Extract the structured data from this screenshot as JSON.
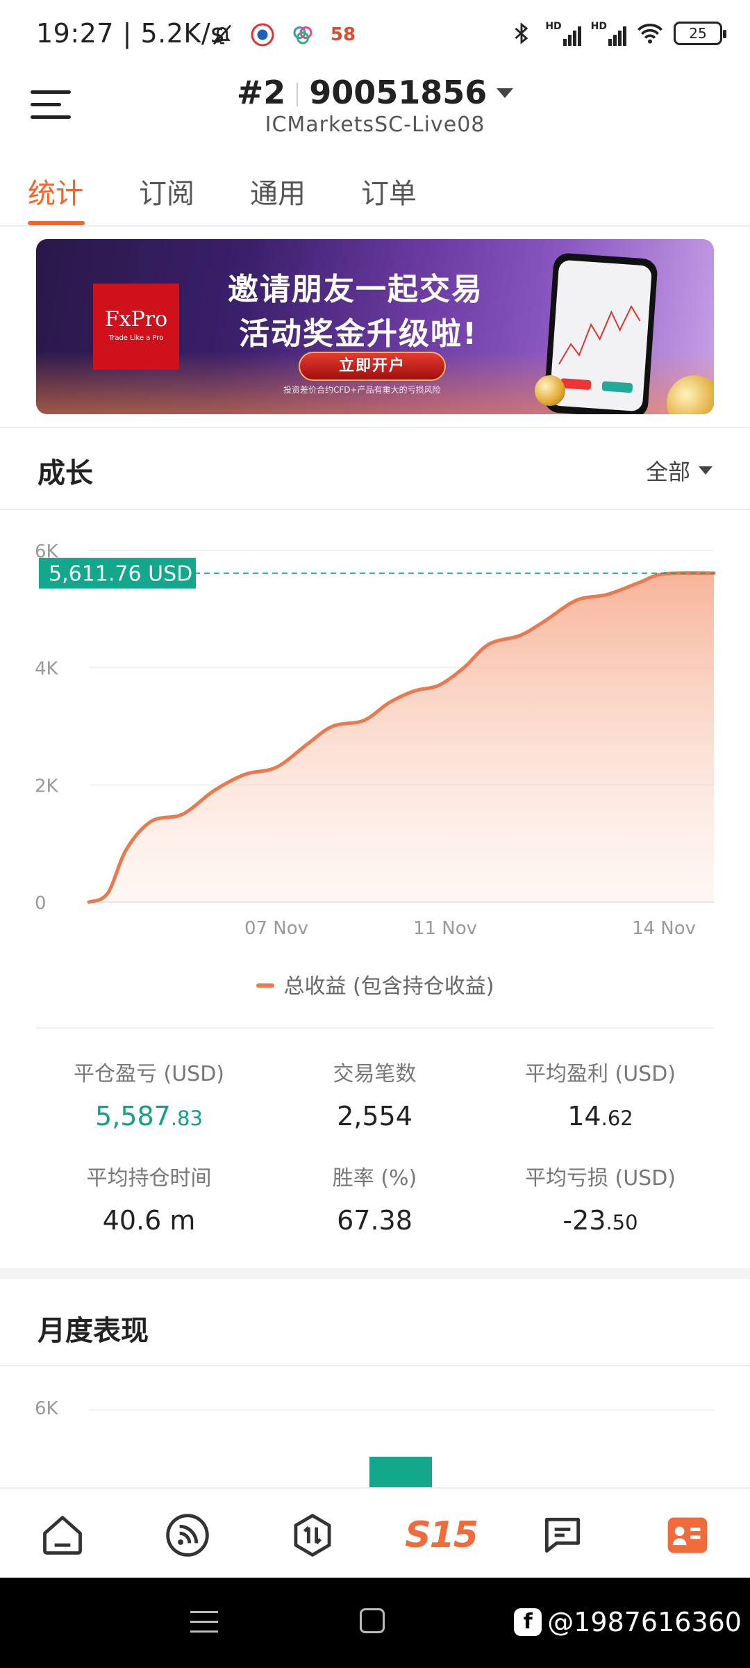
{
  "status_bar": {
    "time": "19:27",
    "speed": "5.2K/s",
    "signal1": "HD",
    "signal2": "HD",
    "battery": "25",
    "app_badge": "58"
  },
  "header": {
    "account_prefix": "#2",
    "account_number": "90051856",
    "server": "ICMarketsSC-Live08"
  },
  "tabs": [
    {
      "label": "统计",
      "active": true
    },
    {
      "label": "订阅",
      "active": false
    },
    {
      "label": "通用",
      "active": false
    },
    {
      "label": "订单",
      "active": false
    }
  ],
  "banner": {
    "logo": "FxPro",
    "logo_tag": "Trade Like a Pro",
    "line1": "邀请朋友一起交易",
    "line2": "活动奖金升级啦!",
    "cta": "立即开户",
    "risk": "投资差价合约CFD+产品有重大的亏损风险"
  },
  "growth": {
    "title": "成长",
    "range": "全部",
    "legend": "总收益 (包含持仓收益)"
  },
  "chart_data": {
    "type": "area",
    "current_label": "5,611.76 USD",
    "current_value": 5611.76,
    "y_ticks": [
      "0",
      "2K",
      "4K",
      "6K"
    ],
    "ylim": [
      0,
      6000
    ],
    "x_tick_labels": [
      "07 Nov",
      "11 Nov",
      "14 Nov"
    ],
    "x_tick_positions": [
      0.3,
      0.57,
      0.92
    ],
    "series": [
      {
        "name": "总收益 (包含持仓收益)",
        "points": [
          [
            0.0,
            0
          ],
          [
            0.03,
            150
          ],
          [
            0.06,
            900
          ],
          [
            0.1,
            1380
          ],
          [
            0.15,
            1500
          ],
          [
            0.2,
            1900
          ],
          [
            0.25,
            2180
          ],
          [
            0.3,
            2300
          ],
          [
            0.35,
            2700
          ],
          [
            0.39,
            3000
          ],
          [
            0.44,
            3100
          ],
          [
            0.48,
            3400
          ],
          [
            0.52,
            3600
          ],
          [
            0.56,
            3700
          ],
          [
            0.6,
            4000
          ],
          [
            0.64,
            4400
          ],
          [
            0.69,
            4550
          ],
          [
            0.73,
            4800
          ],
          [
            0.78,
            5150
          ],
          [
            0.83,
            5250
          ],
          [
            0.88,
            5450
          ],
          [
            0.92,
            5600
          ],
          [
            1.0,
            5611.76
          ]
        ]
      }
    ],
    "colors": {
      "line": "#ea7a4d",
      "fill_top": "#f6b39a",
      "label_bg": "#13a88c",
      "ref_line": "#13a88c"
    }
  },
  "stats": [
    {
      "label": "平仓盈亏 (USD)",
      "int": "5,587",
      "dec": ".83",
      "green": true
    },
    {
      "label": "交易笔数",
      "int": "2,554",
      "dec": "",
      "green": false
    },
    {
      "label": "平均盈利 (USD)",
      "int": "14",
      "dec": ".62",
      "green": false
    },
    {
      "label": "平均持仓时间",
      "int": "40.6 m",
      "dec": "",
      "green": false
    },
    {
      "label": "胜率 (%)",
      "int": "67.38",
      "dec": "",
      "green": false
    },
    {
      "label": "平均亏损 (USD)",
      "int": "-23",
      "dec": ".50",
      "green": false
    }
  ],
  "monthly": {
    "title": "月度表现",
    "y_tick": "6K"
  },
  "bottom_nav": {
    "s15": "S15"
  },
  "watermark": "@1987616360"
}
